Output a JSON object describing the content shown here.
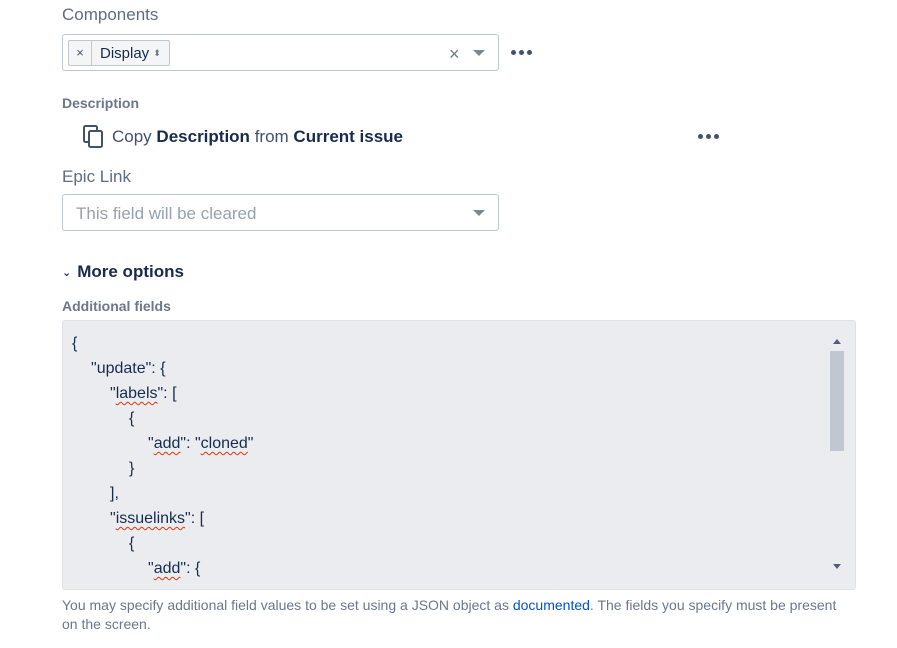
{
  "components": {
    "label": "Components",
    "tag_remove": "×",
    "tag_label": "Display",
    "tag_sort": "⬍",
    "clear": "×"
  },
  "description": {
    "label": "Description",
    "copy_word": "Copy",
    "field_name": "Description",
    "from_word": "from",
    "source": "Current issue"
  },
  "epic_link": {
    "label": "Epic Link",
    "placeholder": "This field will be cleared"
  },
  "more_options": {
    "label": "More options"
  },
  "additional_fields": {
    "label": "Additional fields",
    "json_lines": [
      {
        "indent": 0,
        "text": "{"
      },
      {
        "indent": 1,
        "text": "\"update\": {"
      },
      {
        "indent": 2,
        "text": "\"labels\": ["
      },
      {
        "indent": 3,
        "text": "{"
      },
      {
        "indent": 4,
        "text": "\"add\": \"cloned\""
      },
      {
        "indent": 3,
        "text": "}"
      },
      {
        "indent": 2,
        "text": "],"
      },
      {
        "indent": 2,
        "text": "\"issuelinks\": ["
      },
      {
        "indent": 3,
        "text": "{"
      },
      {
        "indent": 4,
        "text": "\"add\": {"
      }
    ]
  },
  "help": {
    "before_link": "You may specify additional field values to be set using a JSON object as ",
    "link_text": "documented",
    "after_link": ". The fields you specify must be present on the screen."
  }
}
